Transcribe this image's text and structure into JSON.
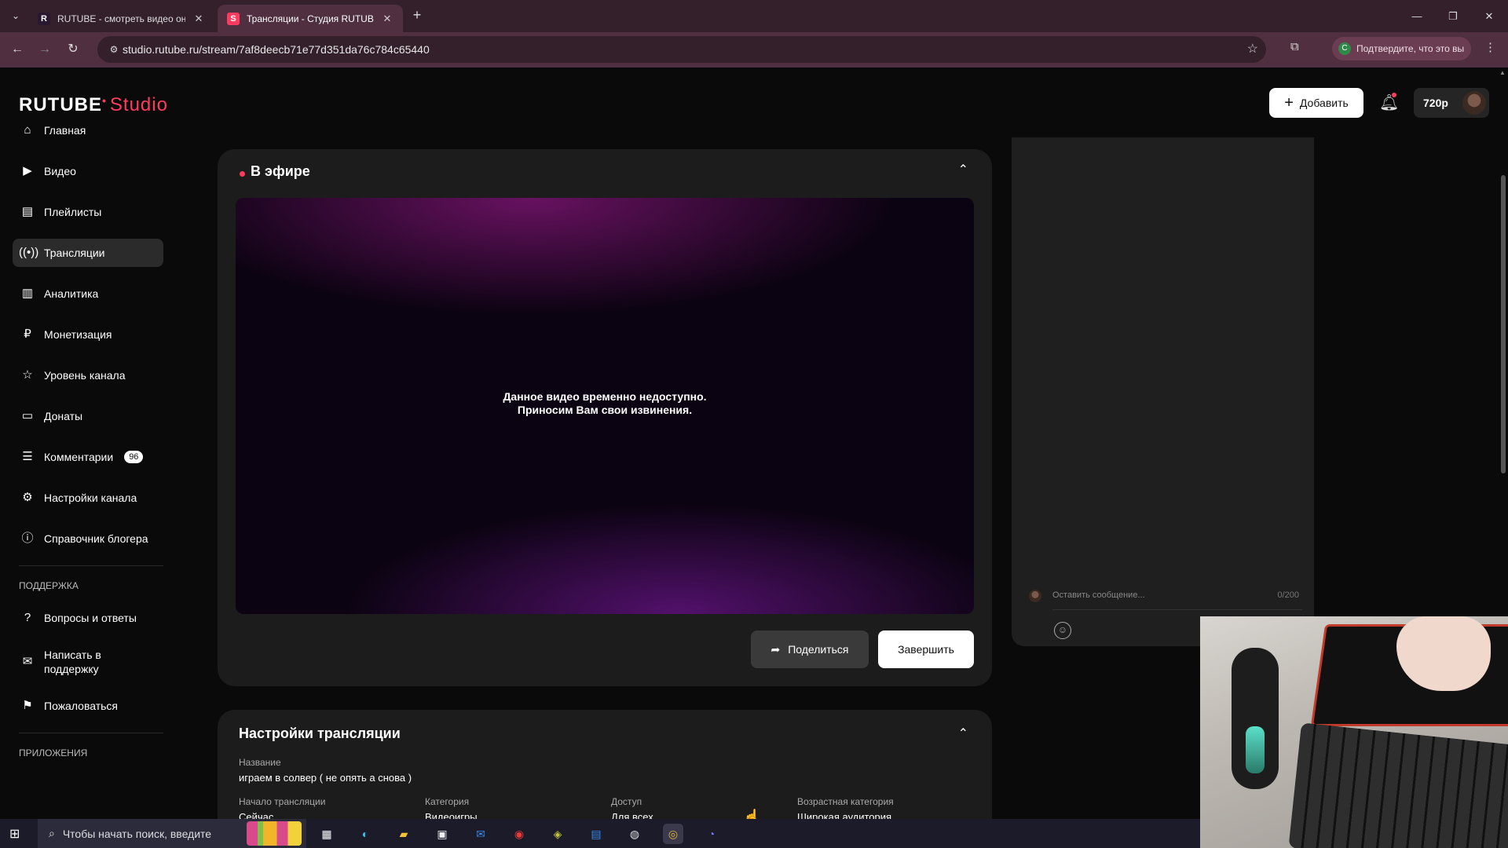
{
  "browser": {
    "tabs": [
      {
        "favicon": "R",
        "title": "RUTUBE - смотреть видео онл",
        "active": false
      },
      {
        "favicon": "S",
        "title": "Трансляции - Студия RUTUBE",
        "active": true
      }
    ],
    "url": "studio.rutube.ru/stream/7af8deecb71e77d351da76c784c65440",
    "profile_chip": "Подтвердите, что это вы"
  },
  "app": {
    "logo_main": "RUTUBE",
    "logo_sub": "Studio",
    "add_button": "Добавить",
    "quality": "720p"
  },
  "sidebar": {
    "items": [
      {
        "label": "Главная",
        "icon": "home-icon"
      },
      {
        "label": "Видео",
        "icon": "video-icon"
      },
      {
        "label": "Плейлисты",
        "icon": "playlist-icon"
      },
      {
        "label": "Трансляции",
        "icon": "broadcast-icon"
      },
      {
        "label": "Аналитика",
        "icon": "analytics-icon"
      },
      {
        "label": "Монетизация",
        "icon": "ruble-icon"
      },
      {
        "label": "Уровень канала",
        "icon": "star-icon"
      },
      {
        "label": "Донаты",
        "icon": "wallet-icon"
      },
      {
        "label": "Комментарии",
        "icon": "comment-icon",
        "badge": "96"
      },
      {
        "label": "Настройки канала",
        "icon": "gear-icon"
      },
      {
        "label": "Справочник блогера",
        "icon": "info-icon"
      }
    ],
    "support_heading": "ПОДДЕРЖКА",
    "support_items": [
      {
        "label": "Вопросы и ответы",
        "icon": "question-icon"
      },
      {
        "label": "Написать в поддержку",
        "icon": "mail-icon"
      },
      {
        "label": "Пожаловаться",
        "icon": "flag-icon"
      }
    ],
    "apps_heading": "ПРИЛОЖЕНИЯ"
  },
  "live": {
    "title": "В эфире",
    "message_line1": "Данное видео временно недоступно.",
    "message_line2": "Приносим Вам свои извинения.",
    "share_button": "Поделиться",
    "end_button": "Завершить"
  },
  "settings": {
    "title": "Настройки трансляции",
    "name_label": "Название",
    "name_value": "играем в солвер ( не опять а снова )",
    "start_label": "Начало трансляции",
    "start_value": "Сейчас",
    "category_label": "Категория",
    "category_value": "Видеоигры",
    "access_label": "Доступ",
    "access_value": "Для всех",
    "age_label": "Возрастная категория",
    "age_value": "Широкая аудитория"
  },
  "chat": {
    "placeholder": "Оставить сообщение...",
    "counter": "0/200"
  },
  "taskbar": {
    "search_placeholder": "Чтобы начать поиск, введите"
  }
}
